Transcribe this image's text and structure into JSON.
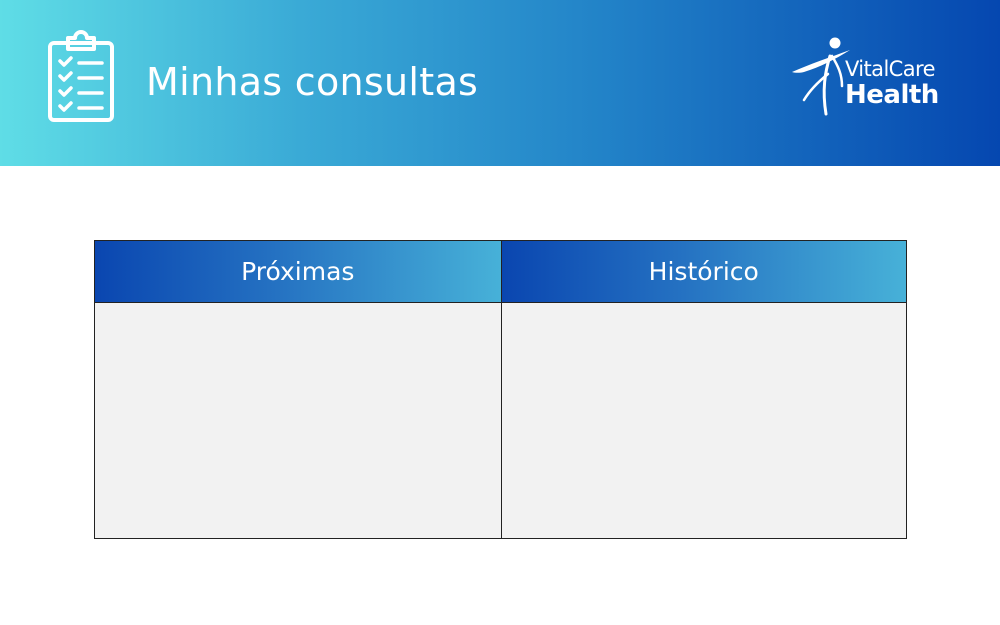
{
  "header": {
    "title": "Minhas consultas",
    "icon": "clipboard-checklist-icon",
    "gradient": [
      "#5fdde6",
      "#0547b0"
    ]
  },
  "brand": {
    "line1": "VitalCare",
    "line2": "Health",
    "icon": "person-figure-icon"
  },
  "tabs": [
    {
      "label": "Próximas"
    },
    {
      "label": "Histórico"
    }
  ],
  "colors": {
    "tab_header_start": "#0a46b0",
    "tab_header_end": "#47b1d8",
    "panel_background": "#f2f2f2",
    "text": "#ffffff"
  }
}
